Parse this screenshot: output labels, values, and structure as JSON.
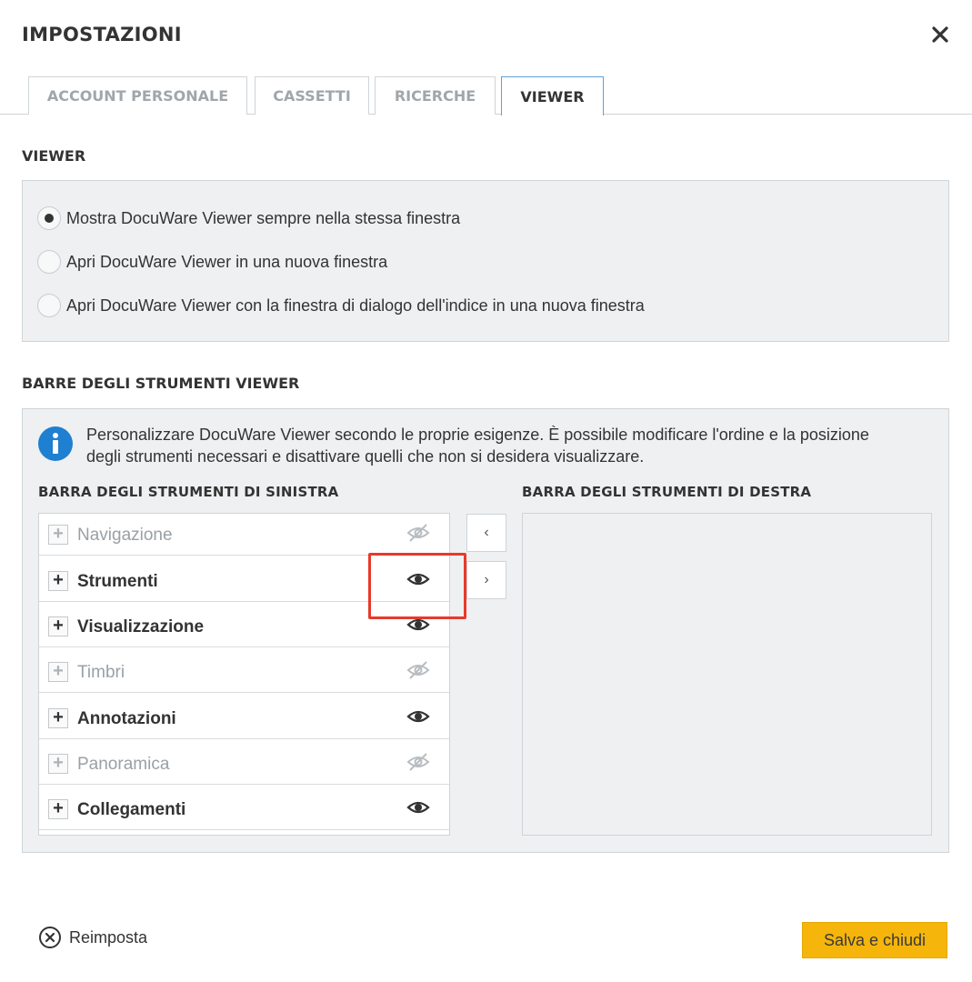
{
  "dialog": {
    "title": "IMPOSTAZIONI"
  },
  "tabs": [
    {
      "label": "ACCOUNT PERSONALE",
      "active": false
    },
    {
      "label": "CASSETTI",
      "active": false
    },
    {
      "label": "RICERCHE",
      "active": false
    },
    {
      "label": "VIEWER",
      "active": true
    }
  ],
  "viewer_section": {
    "title": "VIEWER",
    "options": [
      {
        "label": "Mostra DocuWare Viewer sempre nella stessa finestra",
        "selected": true
      },
      {
        "label": "Apri DocuWare Viewer in una nuova finestra",
        "selected": false
      },
      {
        "label": "Apri DocuWare Viewer con la finestra di dialogo dell'indice in una nuova finestra",
        "selected": false
      }
    ]
  },
  "toolbars_section": {
    "title": "BARRE DEGLI STRUMENTI VIEWER",
    "info_text": "Personalizzare DocuWare Viewer secondo le proprie esigenze. È possibile modificare l'ordine e la posizione degli strumenti necessari e disattivare quelli che non si desidera visualizzare.",
    "left_title": "BARRA DEGLI STRUMENTI DI SINISTRA",
    "right_title": "BARRA DEGLI STRUMENTI DI DESTRA",
    "left_items": [
      {
        "label": "Navigazione",
        "visible": false
      },
      {
        "label": "Strumenti",
        "visible": true
      },
      {
        "label": "Visualizzazione",
        "visible": true
      },
      {
        "label": "Timbri",
        "visible": false
      },
      {
        "label": "Annotazioni",
        "visible": true
      },
      {
        "label": "Panoramica",
        "visible": false
      },
      {
        "label": "Collegamenti",
        "visible": true
      }
    ],
    "move_left_glyph": "‹",
    "move_right_glyph": "›"
  },
  "footer": {
    "reset_label": "Reimposta",
    "save_label": "Salva e chiudi"
  },
  "colors": {
    "accent_tab_border": "#5fa0d6",
    "save_button": "#f5b50a",
    "highlight": "#e8392b",
    "info_icon": "#1f7fd1"
  }
}
